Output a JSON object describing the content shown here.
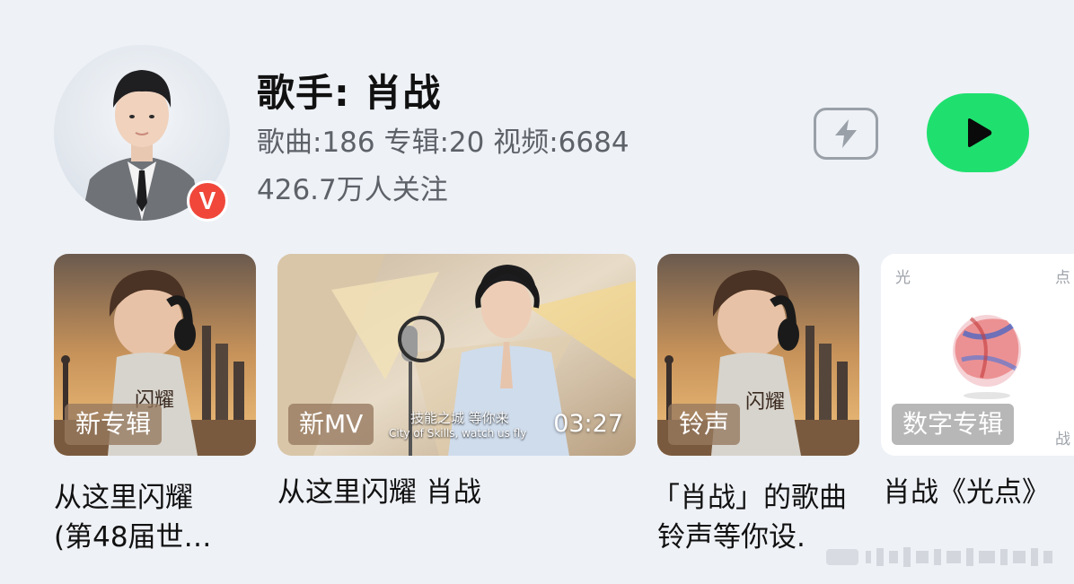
{
  "artist": {
    "title": "歌手: 肖战",
    "stats": "歌曲:186 专辑:20 视频:6684",
    "followers": "426.7万人关注",
    "badge": "V"
  },
  "actions": {
    "flash_icon": "lightning-icon",
    "play_icon": "play-icon",
    "play_color": "#1fe06f"
  },
  "cards": [
    {
      "tag": "新专辑",
      "caption_lines": [
        "从这里闪耀",
        "(第48届世…"
      ]
    },
    {
      "tag": "新MV",
      "duration": "03:27",
      "subtitle_cn": "技能之城 等你来",
      "subtitle_en": "City of Skills, watch us fly",
      "caption_lines": [
        "从这里闪耀 肖战"
      ]
    },
    {
      "tag": "铃声",
      "caption_lines": [
        "「肖战」的歌曲",
        "铃声等你设."
      ]
    },
    {
      "tag": "数字专辑",
      "corner_top_left": "光",
      "corner_top_right": "点",
      "corner_bottom_right": "战",
      "caption_lines": [
        "肖战《光点》"
      ]
    }
  ]
}
